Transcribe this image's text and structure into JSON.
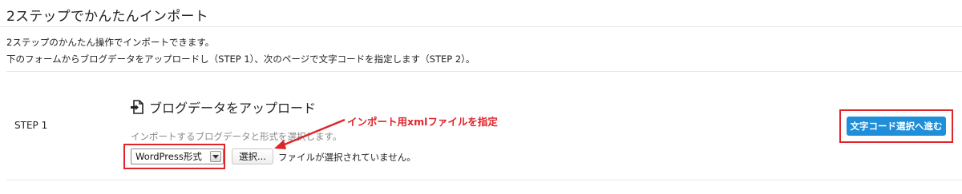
{
  "page": {
    "title": "2ステップでかんたんインポート",
    "description_line1": "2ステップのかんたん操作でインポートできます。",
    "description_line2": "下のフォームからブログデータをアップロードし（STEP 1）、次のページで文字コードを指定します（STEP 2）。"
  },
  "step": {
    "label": "STEP 1",
    "section_title": "ブログデータをアップロード",
    "section_icon": "file-upload-icon",
    "hint": "インポートするブログデータと形式を選択します。",
    "format_select": {
      "value": "WordPress形式"
    },
    "file_button_label": "選択...",
    "file_status": "ファイルが選択されていません。"
  },
  "annotation": {
    "text": "インポート用xmlファイルを指定",
    "color": "#e0242a"
  },
  "actions": {
    "next_button_label": "文字コード選択へ進む",
    "next_button_color": "#1e8fd8"
  }
}
